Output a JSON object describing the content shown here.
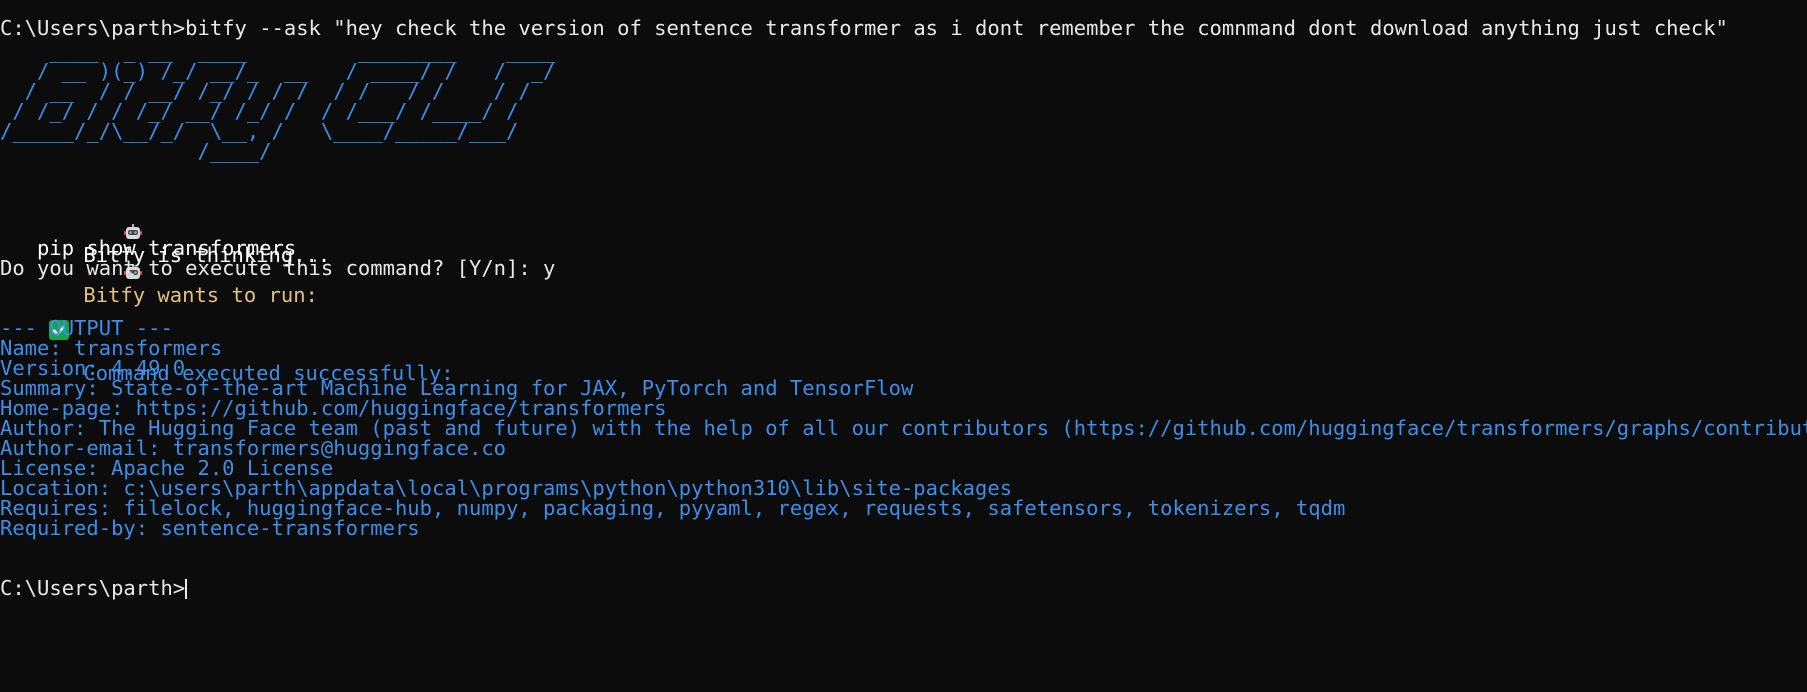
{
  "prompt_path": "C:\\Users\\parth>",
  "command_typed": "bitfy --ask \"hey check the version of sentence transformer as i dont remember the comnmand dont download anything just check\"",
  "ascii_banner": [
    "    ____  _ __  ____         ________    ____",
    "   / __ )(_) /_/ __/_  __   / ____/ /   /  _/",
    "  / __  / / __/ /_/ / / /  / /   / /    / /  ",
    " / /_/ / / /_/ __/ /_/ /  / /___/ /____/ /   ",
    "/_____/_/\\__/_/  \\__, /   \\____/_____/___/   ",
    "                /____/                       "
  ],
  "thinking_text": "Bitfy is thinking...",
  "wants_to_run_label": "Bitfy wants to run:",
  "proposed_command": "   pip show transformers",
  "confirm_prompt": "Do you want to execute this command? [Y/n]: y",
  "success_text": "Command executed successfully:",
  "output_header": "--- OUTPUT ---",
  "output_lines": [
    "Name: transformers",
    "Version: 4.49.0",
    "Summary: State-of-the-art Machine Learning for JAX, PyTorch and TensorFlow",
    "Home-page: https://github.com/huggingface/transformers",
    "Author: The Hugging Face team (past and future) with the help of all our contributors (https://github.com/huggingface/transformers/graphs/contributors)",
    "Author-email: transformers@huggingface.co",
    "License: Apache 2.0 License",
    "Location: c:\\users\\parth\\appdata\\local\\programs\\python\\python310\\lib\\site-packages",
    "Requires: filelock, huggingface-hub, numpy, packaging, pyyaml, regex, requests, safetensors, tokenizers, tqdm",
    "Required-by: sentence-transformers"
  ],
  "final_prompt": "C:\\Users\\parth>",
  "icons": {
    "robot": "robot-face-icon",
    "check": "check-mark-button-icon"
  },
  "colors": {
    "background": "#0c0c0c",
    "text": "#e8e8e8",
    "output_blue": "#3b8eea",
    "highlight_yellow": "#e5c07b",
    "success_green": "#16a34a"
  }
}
